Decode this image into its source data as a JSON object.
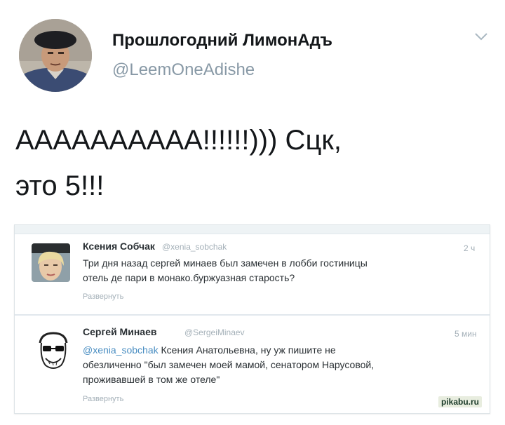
{
  "tweet": {
    "display_name": "Прошлогодний ЛимонАдъ",
    "handle": "@LeemOneAdishe",
    "text_line1": "АААААААААА!!!!!!))) Сцк,",
    "text_line2": "это 5!!!"
  },
  "embedded": {
    "tweets": [
      {
        "name": "Ксения Собчак",
        "handle": "@xenia_sobchak",
        "time": "2 ч",
        "line1": "Три дня назад сергей минаев был замечен в лобби гостиницы",
        "line2": "отель де пари в монако.буржуазная старость?",
        "expand": "Развернуть"
      },
      {
        "name": "Сергей Минаев",
        "handle": "@SergeiMinaev",
        "time": "5 мин",
        "mention": "@xenia_sobchak",
        "line1_rest": " Ксения Анатольевна, ну уж пишите не",
        "line2": "обезличенно \"был замечен моей мамой, сенатором Нарусовой,",
        "line3": "проживавшей в том же отеле\"",
        "expand": "Развернуть"
      }
    ]
  },
  "watermark": "pikabu.ru"
}
